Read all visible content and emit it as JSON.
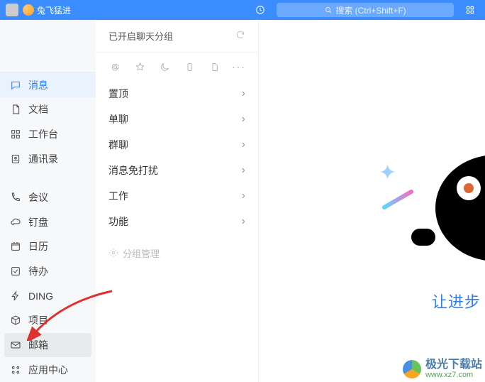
{
  "titlebar": {
    "username": "兔飞猛进",
    "search_placeholder": "搜索 (Ctrl+Shift+F)"
  },
  "sidebar": {
    "items": [
      {
        "label": "消息",
        "icon": "message"
      },
      {
        "label": "文档",
        "icon": "document"
      },
      {
        "label": "工作台",
        "icon": "grid"
      },
      {
        "label": "通讯录",
        "icon": "contacts"
      },
      {
        "label": "会议",
        "icon": "phone"
      },
      {
        "label": "钉盘",
        "icon": "cloud"
      },
      {
        "label": "日历",
        "icon": "calendar"
      },
      {
        "label": "待办",
        "icon": "check"
      },
      {
        "label": "DING",
        "icon": "bolt"
      },
      {
        "label": "项目",
        "icon": "cube"
      },
      {
        "label": "邮箱",
        "icon": "mail"
      },
      {
        "label": "应用中心",
        "icon": "apps"
      }
    ]
  },
  "mid": {
    "header": "已开启聊天分组",
    "groups": [
      {
        "label": "置顶"
      },
      {
        "label": "单聊"
      },
      {
        "label": "群聊"
      },
      {
        "label": "消息免打扰"
      },
      {
        "label": "工作"
      },
      {
        "label": "功能"
      }
    ],
    "manage": "分组管理"
  },
  "content": {
    "slogan": "让进步",
    "watermark_name": "极光下载站",
    "watermark_url": "www.xz7.com"
  }
}
